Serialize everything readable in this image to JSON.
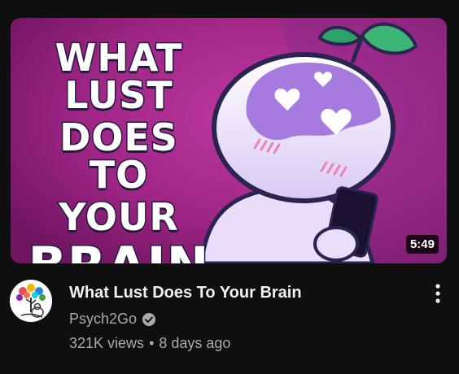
{
  "thumbnail": {
    "title_lines": [
      "WHAT LUST",
      "DOES TO",
      "YOUR",
      "BRAIN"
    ],
    "duration": "5:49",
    "icon": "cartoon-brain-character-holding-phone"
  },
  "video": {
    "title": "What Lust Does To Your Brain",
    "channel": "Psych2Go",
    "views": "321K views",
    "separator": "•",
    "age": "8 days ago"
  },
  "icons": {
    "verified": "verified-check-icon",
    "menu": "more-vert-icon",
    "avatar": "channel-avatar-tree-logo"
  },
  "colors": {
    "background": "#0f0f0f",
    "title_text": "#f1f1f1",
    "secondary_text": "#aaaaaa",
    "thumbnail_magenta": "#a3288a",
    "thumbnail_purple": "#7b2f86"
  }
}
